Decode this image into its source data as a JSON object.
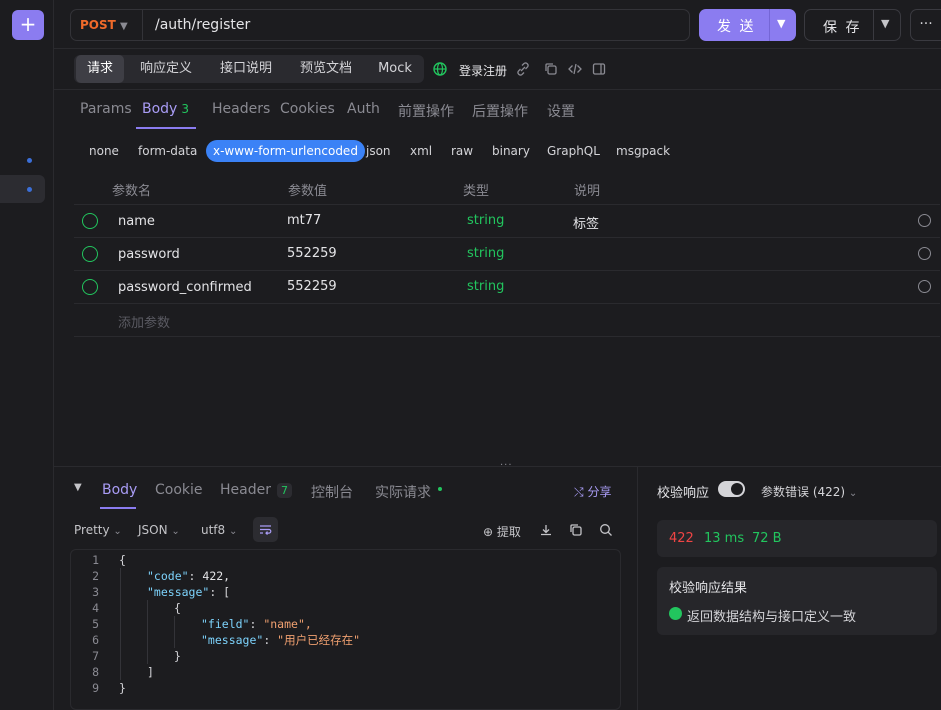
{
  "sidebar": {
    "add_label": "+"
  },
  "request": {
    "method": "POST",
    "url": "/auth/register",
    "send_label": "发 送",
    "save_label": "保 存",
    "more_label": "···"
  },
  "segments": [
    {
      "label": "请求",
      "active": true
    },
    {
      "label": "响应定义"
    },
    {
      "label": "接口说明"
    },
    {
      "label": "预览文档"
    },
    {
      "label": "Mock"
    }
  ],
  "api_name": "登录注册",
  "tabs": {
    "params": "Params",
    "body": "Body",
    "body_count": "3",
    "headers": "Headers",
    "cookies": "Cookies",
    "auth": "Auth",
    "pre": "前置操作",
    "post": "后置操作",
    "settings": "设置"
  },
  "body_types": [
    "none",
    "form-data",
    "x-www-form-urlencoded",
    "json",
    "xml",
    "raw",
    "binary",
    "GraphQL",
    "msgpack"
  ],
  "params_table": {
    "headers": [
      "参数名",
      "参数值",
      "类型",
      "说明"
    ],
    "rows": [
      {
        "name": "name",
        "value": "mt77",
        "type": "string",
        "desc": "标签"
      },
      {
        "name": "password",
        "value": "552259",
        "type": "string",
        "desc": ""
      },
      {
        "name": "password_confirmed",
        "value": "552259",
        "type": "string",
        "desc": ""
      }
    ],
    "add_label": "添加参数"
  },
  "response": {
    "tabs": {
      "body": "Body",
      "cookie": "Cookie",
      "header": "Header",
      "header_count": "7",
      "console": "控制台",
      "actual": "实际请求"
    },
    "share": "分享",
    "format": "Pretty",
    "lang": "JSON",
    "encoding": "utf8",
    "extract": "提取",
    "code_lines": [
      {
        "n": "1",
        "text": "{"
      },
      {
        "n": "2",
        "key": "\"code\"",
        "val": "422,"
      },
      {
        "n": "3",
        "key": "\"message\"",
        "val": "["
      },
      {
        "n": "4",
        "text": "{"
      },
      {
        "n": "5",
        "key": "\"field\"",
        "sval": "\"name\","
      },
      {
        "n": "6",
        "key": "\"message\"",
        "sval": "\"用户已经存在\""
      },
      {
        "n": "7",
        "text": "}"
      },
      {
        "n": "8",
        "text": "]"
      },
      {
        "n": "9",
        "text": "}"
      }
    ]
  },
  "validation": {
    "label": "校验响应",
    "status": "参数错误 (422)",
    "code": "422",
    "time": "13 ms",
    "size": "72 B",
    "result_title": "校验响应结果",
    "result_text": "返回数据结构与接口定义一致"
  },
  "colors": {
    "accent": "#8b7cf0",
    "success": "#22c55e",
    "error": "#ef4444",
    "method": "#f06a2a"
  }
}
